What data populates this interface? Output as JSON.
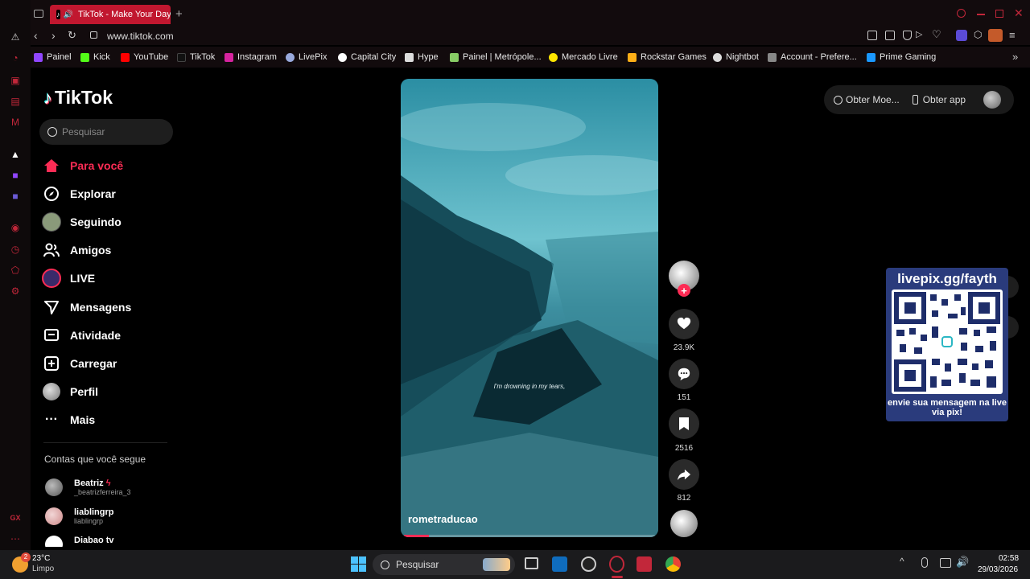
{
  "browser": {
    "tab_title": "TikTok - Make Your Day",
    "url": "www.tiktok.com",
    "bookmarks": [
      "Painel",
      "Kick",
      "YouTube",
      "TikTok",
      "Instagram",
      "LivePix",
      "Capital City",
      "Hype",
      "Painel | Metrópole...",
      "Mercado Livre",
      "Rockstar Games",
      "Nightbot",
      "Account - Prefere...",
      "Prime Gaming"
    ],
    "side_label": "GX"
  },
  "tiktok": {
    "logo": "TikTok",
    "search_placeholder": "Pesquisar",
    "nav": [
      "Para você",
      "Explorar",
      "Seguindo",
      "Amigos",
      "LIVE",
      "Mensagens",
      "Atividade",
      "Carregar",
      "Perfil",
      "Mais"
    ],
    "following_title": "Contas que você segue",
    "accounts": [
      {
        "name": "Beatriz",
        "handle": "_beatrizferreira_3"
      },
      {
        "name": "liablingrp",
        "handle": "liablingrp"
      },
      {
        "name": "Diabao tv",
        "handle": ""
      }
    ],
    "top_right": {
      "coins": "Obter Moe...",
      "app": "Obter app"
    },
    "video": {
      "subtitle": "I'm drowning in my tears,",
      "username": "rometraducao",
      "progress": 0.1
    },
    "counts": {
      "likes": "23.9K",
      "comments": "151",
      "saves": "2516",
      "shares": "812"
    }
  },
  "overlay": {
    "title": "livepix.gg/fayth",
    "footer": "envie sua mensagem na live via pix!"
  },
  "taskbar": {
    "temp": "23°C",
    "weather": "Limpo",
    "search": "Pesquisar",
    "time": "02:58",
    "date": "29/03/2026",
    "weather_badge": "2"
  },
  "colors": {
    "accent": "#fe2c55",
    "opera_red": "#c2273a",
    "overlay_bg": "#2a3b7c"
  }
}
